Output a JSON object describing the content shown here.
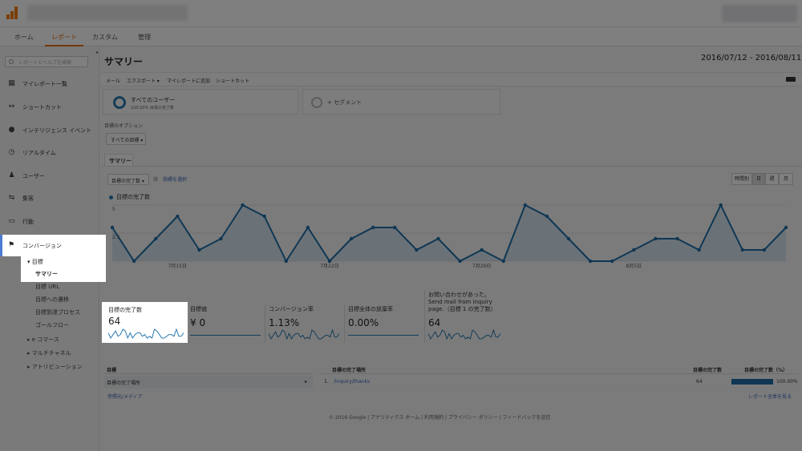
{
  "nav": {
    "tabs": [
      "ホーム",
      "レポート",
      "カスタム",
      "管理"
    ],
    "active": "レポート"
  },
  "search": {
    "placeholder": "レポートとヘルプを検索"
  },
  "sidebar": {
    "items": [
      {
        "label": "マイレポート一覧",
        "icon": "grid-icon"
      },
      {
        "label": "ショートカット",
        "icon": "shortcut-icon"
      },
      {
        "label": "インテリジェンス イベント",
        "icon": "lightbulb-icon"
      },
      {
        "label": "リアルタイム",
        "icon": "clock-icon"
      },
      {
        "label": "ユーザー",
        "icon": "users-icon"
      },
      {
        "label": "集客",
        "icon": "acquisition-icon"
      },
      {
        "label": "行動",
        "icon": "behavior-icon"
      },
      {
        "label": "コンバージョン",
        "icon": "flag-icon"
      }
    ],
    "goals_label": "▾ 目標",
    "goals_sub": [
      "サマリー",
      "目標 URL",
      "目標への遷移",
      "目標到達プロセス",
      "ゴールフロー"
    ],
    "conv_more": [
      "▸ e コマース",
      "▸ マルチチャネル",
      "▸ アトリビューション"
    ]
  },
  "header": {
    "title": "サマリー",
    "date_range": "2016/07/12 - 2016/08/11"
  },
  "toolbar": {
    "items": [
      "メール",
      "エクスポート ▾",
      "マイレポートに追加",
      "ショートカット"
    ]
  },
  "segments": {
    "all_users": "すべてのユーザー",
    "all_users_sub": "100.00% 目標の完了数",
    "add": "+ セグメント"
  },
  "goal_options": {
    "label": "目標のオプション",
    "select": "すべての目標 ▾"
  },
  "tab": {
    "summary": "サマリー"
  },
  "chart_controls": {
    "metric": "目標の完了数 ▾",
    "vs": "対",
    "pick": "指標を選択",
    "granularity": [
      "時間別",
      "日",
      "週",
      "月"
    ],
    "active": "日"
  },
  "chart_data": {
    "type": "area",
    "series": [
      {
        "name": "目標の完了数",
        "values": [
          3,
          0,
          2,
          4,
          1,
          2,
          5,
          4,
          0,
          3,
          0,
          2,
          3,
          3,
          1,
          2,
          0,
          1,
          0,
          5,
          4,
          2,
          0,
          0,
          1,
          2,
          2,
          1,
          5,
          1,
          1,
          3
        ]
      }
    ],
    "x": [
      "7/12",
      "7/13",
      "7/14",
      "7/15",
      "7/16",
      "7/17",
      "7/18",
      "7/19",
      "7/20",
      "7/21",
      "7/22",
      "7/23",
      "7/24",
      "7/25",
      "7/26",
      "7/27",
      "7/28",
      "7/29",
      "7/30",
      "7/31",
      "8/1",
      "8/2",
      "8/3",
      "8/4",
      "8/5",
      "8/6",
      "8/7",
      "8/8",
      "8/9",
      "8/10",
      "8/11",
      "8/12"
    ],
    "tick_labels": [
      "7月15日",
      "7月22日",
      "7月29日",
      "8月5日"
    ],
    "y_ticks": [
      "5",
      "2.5"
    ],
    "ylim": [
      0,
      5
    ],
    "legend": "目標の完了数",
    "color": "#1f6fa8"
  },
  "scorecards": [
    {
      "label": "目標の完了数",
      "value": "64"
    },
    {
      "label": "目標値",
      "value": "¥ 0"
    },
    {
      "label": "コンバージョン率",
      "value": "1.13%"
    },
    {
      "label": "目標全体の放棄率",
      "value": "0.00%"
    },
    {
      "label": "お問い合わせがあった。Send mail from inquiry page.（目標 1 の完了数）",
      "value": "64"
    }
  ],
  "goal_table": {
    "left_header": "目標",
    "left_row": "目標の完了場所",
    "link": "参照元/メディア"
  },
  "location_table": {
    "headers": [
      "目標の完了場所",
      "目標の完了数",
      "目標の完了数（%）"
    ],
    "rows": [
      {
        "index": "1.",
        "path": "/inquiry/thanks",
        "count": "64",
        "percent": "100.00%"
      }
    ],
    "view_full": "レポート全体を見る"
  },
  "footer": {
    "text": "© 2016 Google | アナリティクス ホーム | 利用規約 | プライバシー ポリシー | フィードバックを送信"
  }
}
